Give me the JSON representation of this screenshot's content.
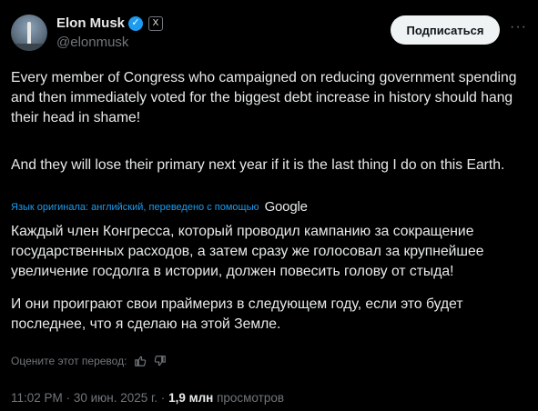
{
  "author": {
    "name": "Elon Musk",
    "handle": "@elonmusk",
    "verified_color": "#1d9bf0",
    "badge": "X"
  },
  "actions": {
    "subscribe_label": "Подписаться",
    "more_label": "···"
  },
  "post": {
    "paragraph1": "Every member of Congress who campaigned on reducing government spending and then immediately voted for the biggest debt increase in history should hang their head in shame!",
    "paragraph2": "And they will lose their primary next year if it is the last thing I do on this Earth."
  },
  "translation": {
    "label": "Язык оригинала: английский, переведено с помощью",
    "provider": "Google",
    "paragraph1": "Каждый член Конгресса, который проводил кампанию за сокращение государственных расходов, а затем сразу же голосовал за крупнейшее увеличение госдолга в истории, должен повесить голову от стыда!",
    "paragraph2": "И они проиграют свои праймериз в следующем году, если это будет последнее, что я сделаю на этой Земле.",
    "rate_label": "Оцените этот перевод:"
  },
  "meta": {
    "time": "11:02 PM",
    "separator": "·",
    "date": "30 июн. 2025 г.",
    "views_count": "1,9 млн",
    "views_label": "просмотров"
  }
}
